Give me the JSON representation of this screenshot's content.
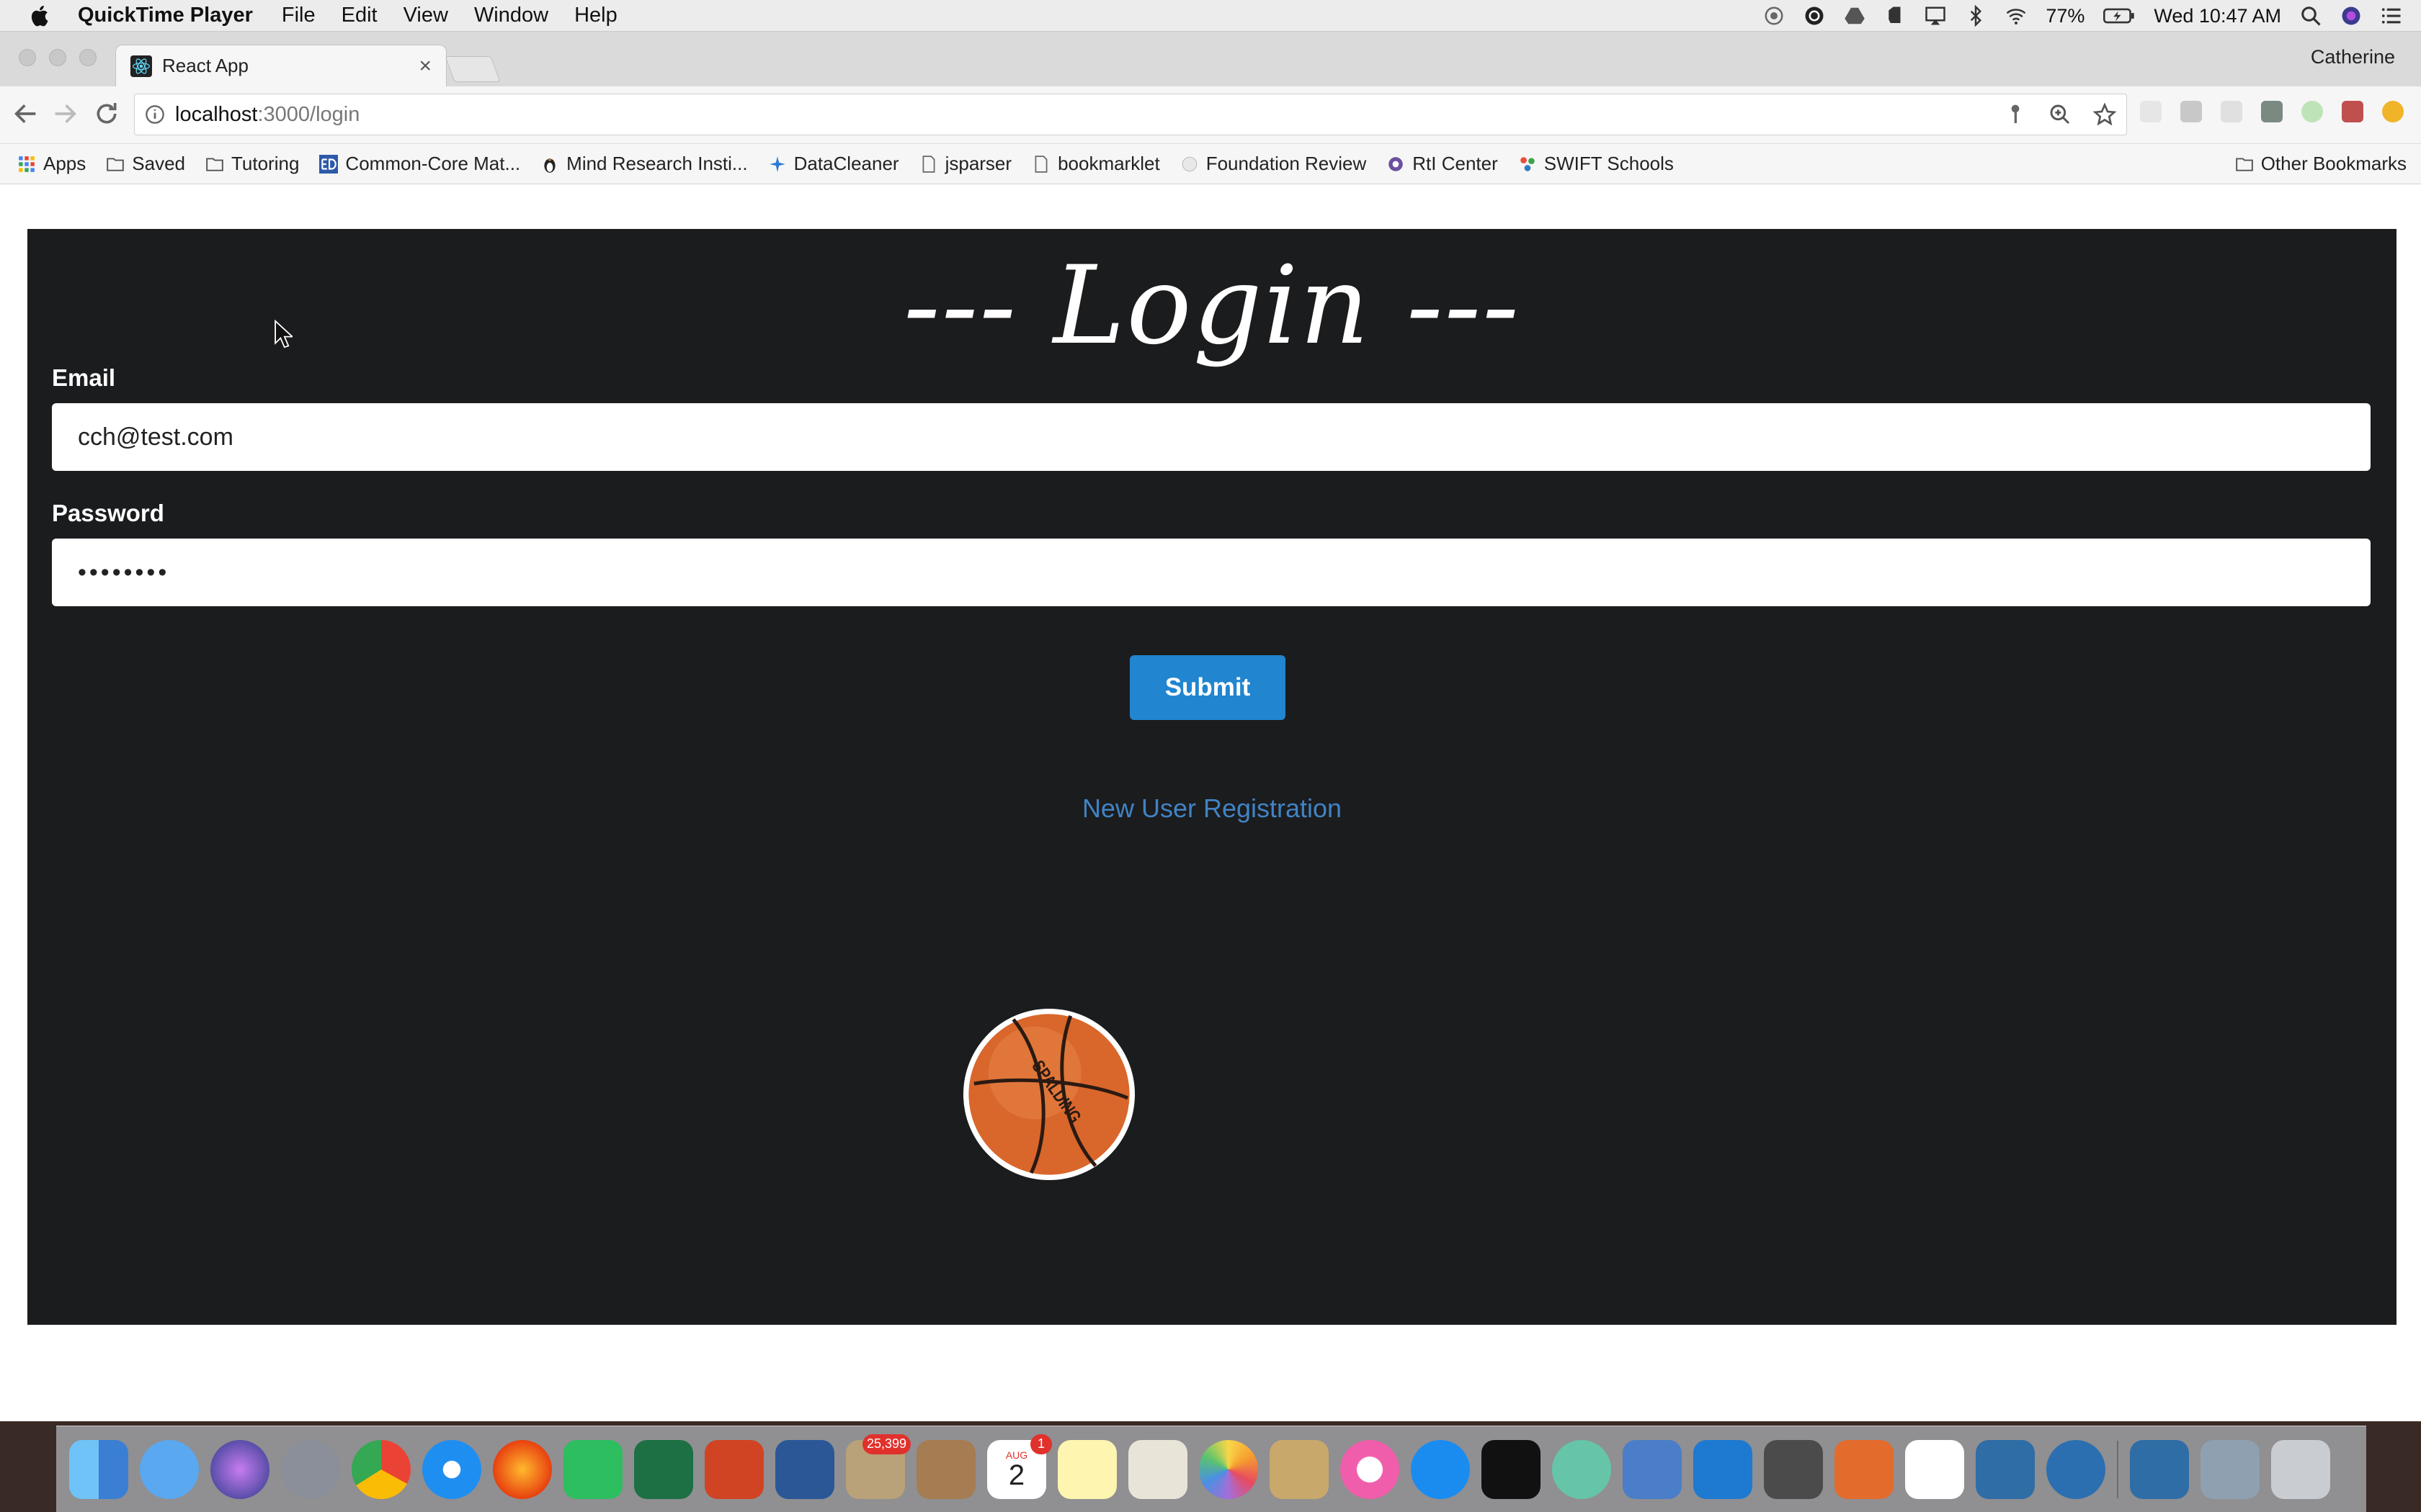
{
  "menubar": {
    "app_name": "QuickTime Player",
    "items": [
      "File",
      "Edit",
      "View",
      "Window",
      "Help"
    ],
    "battery": "77%",
    "clock": "Wed 10:47 AM"
  },
  "browser": {
    "tab_title": "React App",
    "tab_close": "×",
    "profile": "Catherine",
    "url_host": "localhost",
    "url_path": ":3000/login",
    "bookmarks": [
      {
        "label": "Apps"
      },
      {
        "label": "Saved"
      },
      {
        "label": "Tutoring"
      },
      {
        "label": "Common-Core Mat..."
      },
      {
        "label": "Mind Research Insti..."
      },
      {
        "label": "DataCleaner"
      },
      {
        "label": "jsparser"
      },
      {
        "label": "bookmarklet"
      },
      {
        "label": "Foundation Review"
      },
      {
        "label": "RtI Center"
      },
      {
        "label": "SWIFT Schools"
      }
    ],
    "other_bookmarks": "Other Bookmarks"
  },
  "login": {
    "title": "--- Login ---",
    "email_label": "Email",
    "email_value": "cch@test.com",
    "password_label": "Password",
    "password_value": "••••••••",
    "submit_label": "Submit",
    "register_link": "New User Registration",
    "ball_text": "SPALDING"
  },
  "dock": {
    "mail_badge": "25,399",
    "calendar_month": "AUG",
    "calendar_day": "2",
    "calendar_badge": "1"
  },
  "colors": {
    "panel_bg": "#1b1c1e",
    "submit_bg": "#2185d0",
    "link": "#4183c4"
  }
}
